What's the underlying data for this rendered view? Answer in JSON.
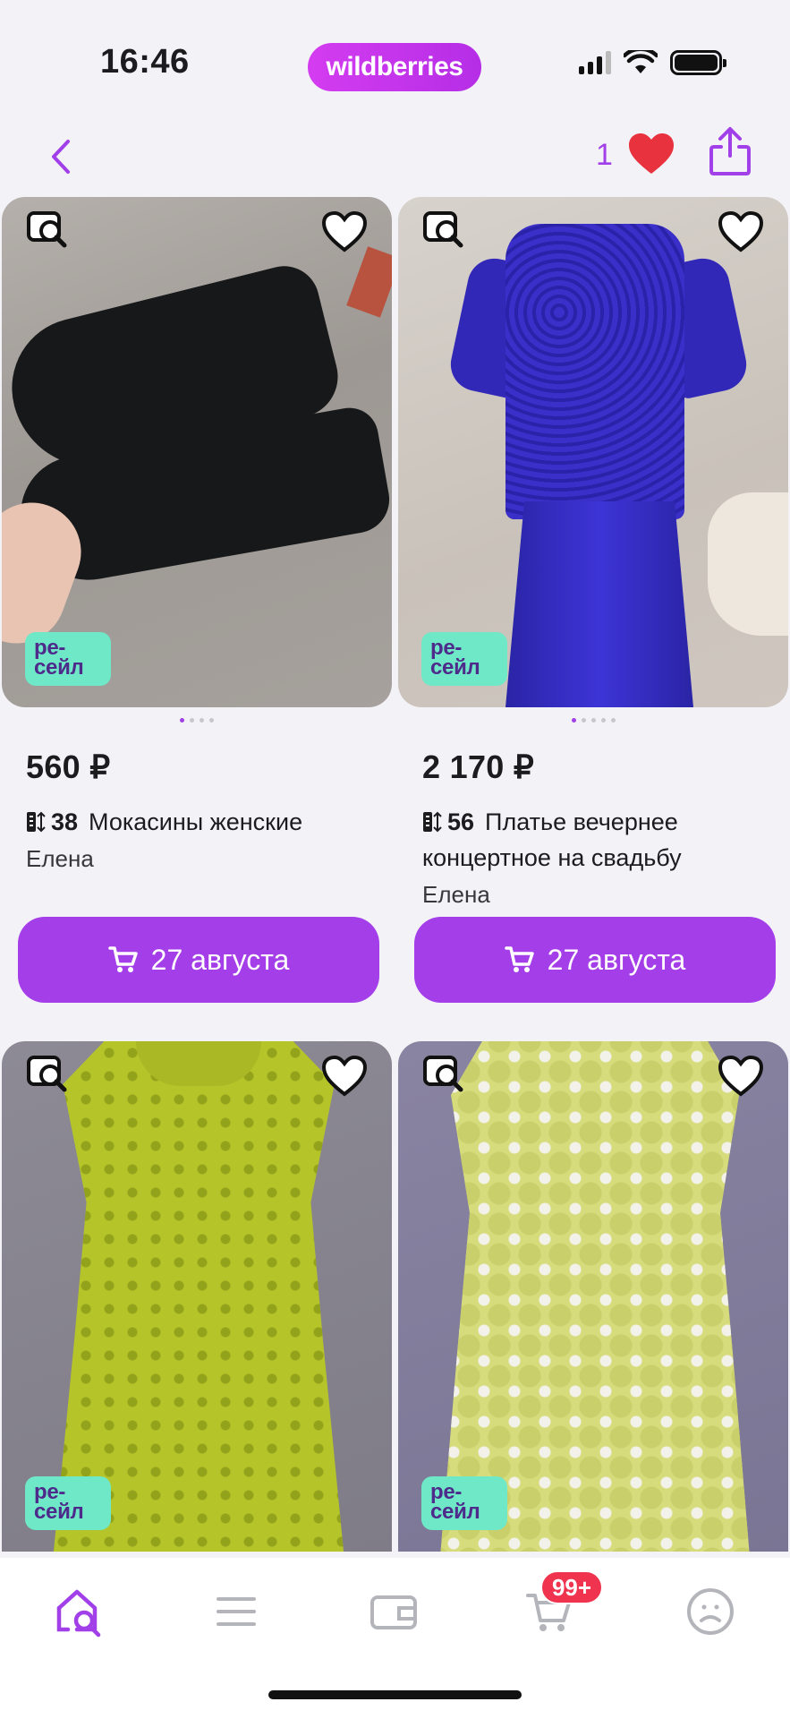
{
  "status_bar": {
    "time": "16:46",
    "brand": "wildberries"
  },
  "nav": {
    "favorites_count": "1"
  },
  "products": [
    {
      "price": "560 ₽",
      "size": "38",
      "title": "Мокасины женские",
      "seller": "Елена",
      "badge_line1": "ре-",
      "badge_line2": "сейл",
      "delivery": "27 августа",
      "image_dots": 4,
      "active_dot": 0
    },
    {
      "price": "2 170 ₽",
      "size": "56",
      "title": "Платье вечернее концертное на свадьбу",
      "seller": "Елена",
      "badge_line1": "ре-",
      "badge_line2": "сейл",
      "delivery": "27 августа",
      "image_dots": 5,
      "active_dot": 0
    },
    {
      "badge_line1": "ре-",
      "badge_line2": "сейл"
    },
    {
      "badge_line1": "ре-",
      "badge_line2": "сейл"
    }
  ],
  "tab_bar": {
    "cart_badge": "99+"
  },
  "colors": {
    "accent": "#a43ee9",
    "badge_bg": "#6ee8c7",
    "favorite_heart": "#e8323e",
    "cart_badge": "#f0334e"
  },
  "icons": [
    "back-arrow-icon",
    "heart-filled-icon",
    "share-icon",
    "search-similar-icon",
    "heart-outline-icon",
    "cart-icon",
    "size-icon",
    "home-search-icon",
    "menu-icon",
    "wallet-icon",
    "profile-icon"
  ]
}
